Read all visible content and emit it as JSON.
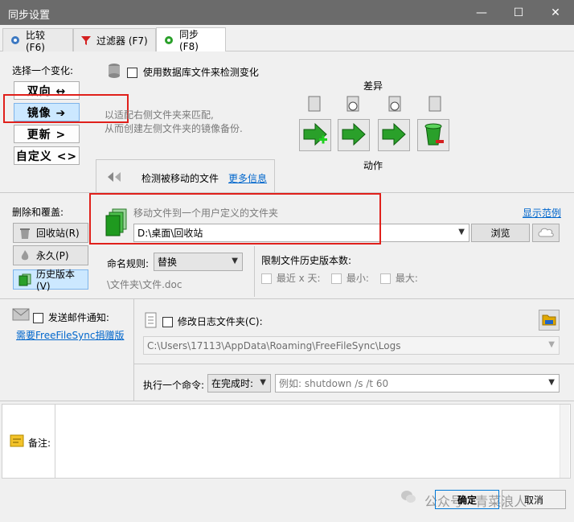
{
  "window": {
    "title": "同步设置",
    "minimize": "—",
    "maximize": "☐",
    "close": "✕"
  },
  "tabs": [
    {
      "label": "比较 (F6)",
      "icon": "gear-icon"
    },
    {
      "label": "过滤器 (F7)",
      "icon": "funnel-icon"
    },
    {
      "label": "同步 (F8)",
      "icon": "gear-icon"
    }
  ],
  "variant": {
    "heading": "选择一个变化:",
    "buttons": [
      {
        "label": "双向 ↔"
      },
      {
        "label": "镜像 ➔"
      },
      {
        "label": "更新 >"
      },
      {
        "label": "自定义 <>"
      }
    ],
    "db_checkbox_label": "使用数据库文件来检测变化",
    "description_line1": "以适配右侧文件夹来匹配,",
    "description_line2": "从而创建左侧文件夹的镜像备份.",
    "diff_label": "差异",
    "action_label": "动作",
    "detect_moved_label": "检测被移动的文件",
    "more_info_link": "更多信息"
  },
  "deletion": {
    "heading": "删除和覆盖:",
    "options": [
      {
        "label": "回收站(R)"
      },
      {
        "label": "永久(P)"
      },
      {
        "label": "历史版本(V)"
      }
    ],
    "move_hint": "移动文件到一个用户定义的文件夹",
    "show_example_link": "显示范例",
    "folder_path": "D:\\桌面\\回收站",
    "browse_button": "浏览",
    "naming_label": "命名规则:",
    "naming_value": "替换",
    "naming_example": "\\文件夹\\文件.doc",
    "limit_label": "限制文件历史版本数:",
    "limit_last_days": "最近 x 天:",
    "limit_min": "最小:",
    "limit_max": "最大:"
  },
  "email": {
    "checkbox_label": "发送邮件通知:",
    "donate_link": "需要FreeFileSync捐赠版"
  },
  "log": {
    "checkbox_label": "修改日志文件夹(C):",
    "path": "C:\\Users\\17113\\AppData\\Roaming\\FreeFileSync\\Logs"
  },
  "command": {
    "label": "执行一个命令:",
    "when_value": "在完成时:",
    "placeholder": "例如: shutdown /s /t 60"
  },
  "notes": {
    "label": "备注:"
  },
  "footer": {
    "ok_button": "确定",
    "cancel_button": "取消",
    "watermark": "公众号 · 青菜浪人"
  },
  "colors": {
    "accent_red": "#e0201b",
    "selected_bg": "#cce8ff",
    "arrow_green": "#2aa02a",
    "link_blue": "#0066cc"
  }
}
